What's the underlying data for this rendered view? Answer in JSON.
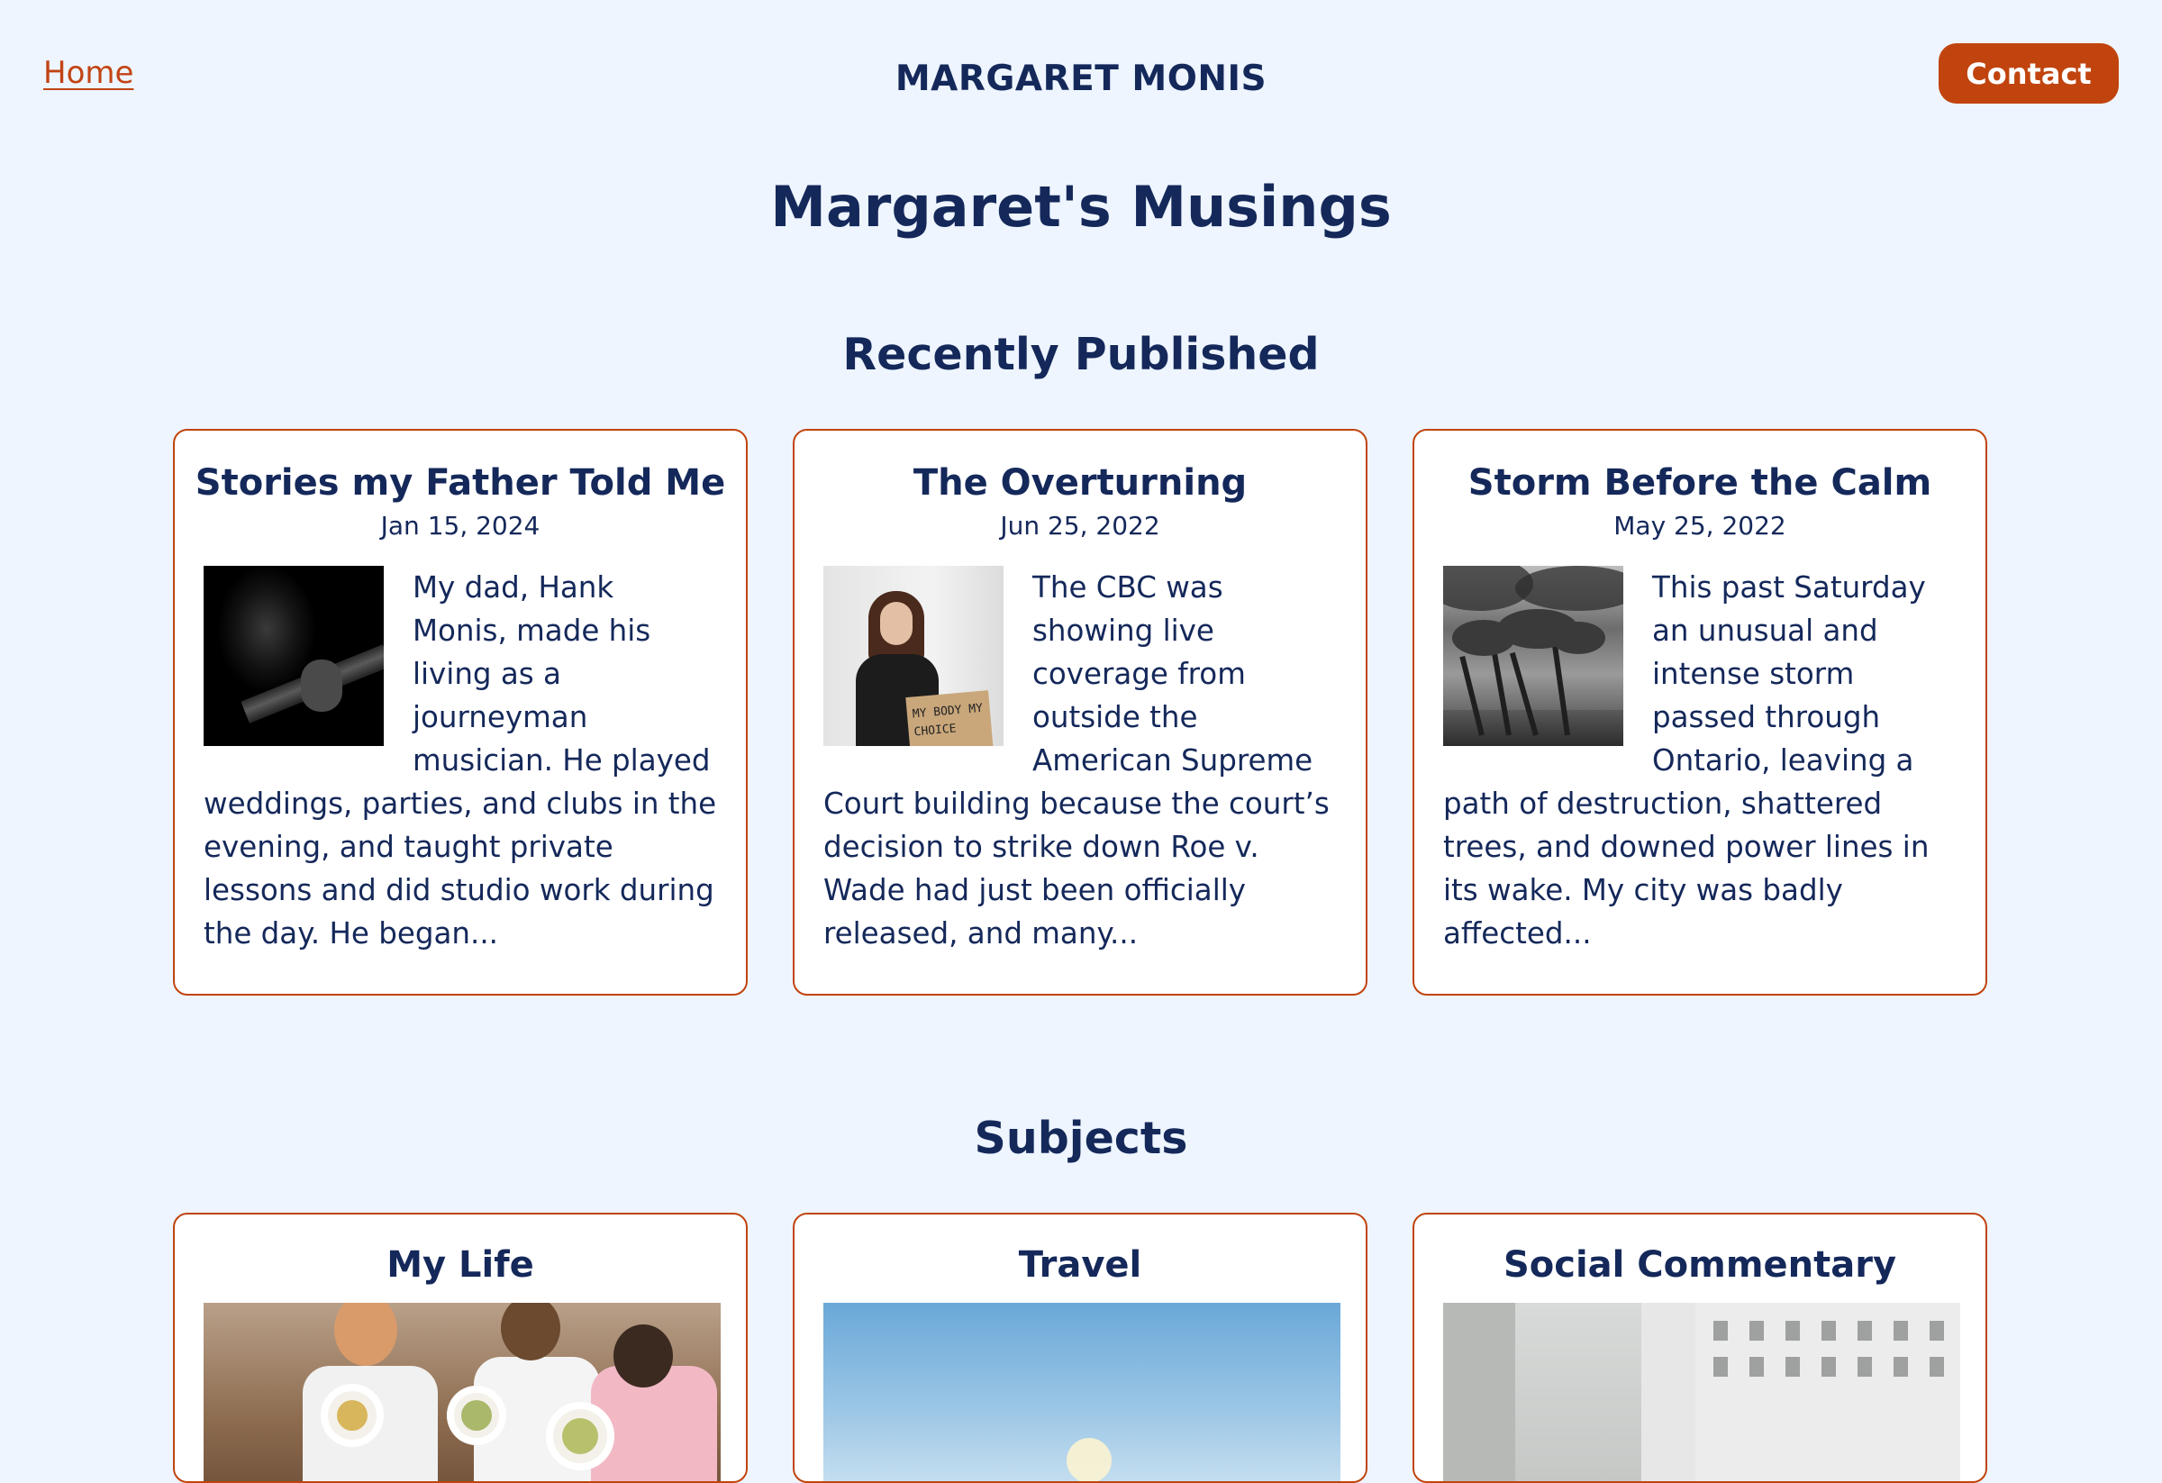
{
  "nav": {
    "home_label": "Home",
    "brand": "MARGARET MONIS",
    "contact_label": "Contact"
  },
  "page": {
    "title": "Margaret's Musings"
  },
  "recent": {
    "heading": "Recently Published",
    "posts": [
      {
        "title": "Stories my Father Told Me",
        "date": "Jan 15, 2024",
        "excerpt": "My dad, Hank Monis, made his living as a journeyman musician. He played weddings, parties, and clubs in the evening, and taught private lessons and did studio work during the day. He began...",
        "image": "man-playing-guitar-photo"
      },
      {
        "title": "The Overturning",
        "date": "Jun 25, 2022",
        "excerpt": "The CBC was showing live coverage from outside the American Supreme Court building because the court’s decision to strike down Roe v. Wade had just been officially released, and many...",
        "image": "protester-with-sign-photo",
        "image_sign_text": "MY BODY MY CHOICE"
      },
      {
        "title": "Storm Before the Calm",
        "date": "May 25, 2022",
        "excerpt": "This past Saturday an unusual and intense storm passed through Ontario, leaving a path of destruction, shattered trees, and downed power lines in its wake. My city was badly affected...",
        "image": "windblown-trees-photo"
      }
    ]
  },
  "subjects": {
    "heading": "Subjects",
    "items": [
      {
        "title": "My Life",
        "image": "friends-dining-photo"
      },
      {
        "title": "Travel",
        "image": "blue-sky-photo"
      },
      {
        "title": "Social Commentary",
        "image": "city-street-photo"
      }
    ]
  },
  "colors": {
    "background": "#eef5ff",
    "text": "#14285a",
    "accent": "#c1440e",
    "card": "#ffffff"
  }
}
